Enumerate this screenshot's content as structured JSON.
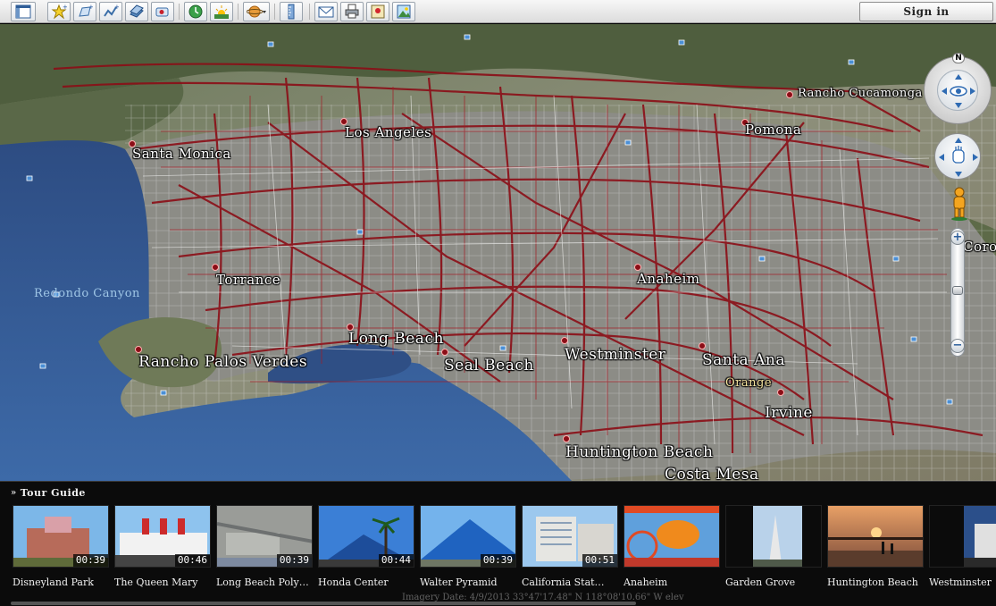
{
  "toolbar": {
    "buttons": [
      {
        "icon": "sidebar-toggle-icon"
      },
      {
        "icon": "add-placemark-icon"
      },
      {
        "icon": "add-polygon-icon"
      },
      {
        "icon": "add-path-icon"
      },
      {
        "icon": "add-image-overlay-icon"
      },
      {
        "icon": "record-tour-icon"
      },
      {
        "icon": "historical-imagery-icon"
      },
      {
        "icon": "sunlight-icon"
      },
      {
        "icon": "planets-icon"
      },
      {
        "icon": "ruler-icon"
      },
      {
        "icon": "email-icon"
      },
      {
        "icon": "print-icon"
      },
      {
        "icon": "view-in-maps-icon"
      },
      {
        "icon": "save-image-icon"
      }
    ],
    "sign_in_label": "Sign in"
  },
  "map": {
    "cities": [
      {
        "name": "Rancho Cucamonga"
      },
      {
        "name": "Los Angeles"
      },
      {
        "name": "Pomona"
      },
      {
        "name": "Santa Monica"
      },
      {
        "name": "Corona"
      },
      {
        "name": "Torrance"
      },
      {
        "name": "Anaheim"
      },
      {
        "name": "Redondo Canyon"
      },
      {
        "name": "Long Beach"
      },
      {
        "name": "Rancho Palos Verdes"
      },
      {
        "name": "Seal Beach"
      },
      {
        "name": "Westminster"
      },
      {
        "name": "Santa Ana"
      },
      {
        "name": "Orange"
      },
      {
        "name": "Irvine"
      },
      {
        "name": "Huntington Beach"
      },
      {
        "name": "Costa Mesa"
      }
    ],
    "compass_north_label": "N",
    "colors": {
      "roads": "#8b0e17",
      "water": "#3b5a8a",
      "land": "#6d7656"
    }
  },
  "tour_guide": {
    "title": "Tour Guide",
    "items": [
      {
        "label": "Disneyland Park",
        "duration": "00:39",
        "thumb": "disneyland"
      },
      {
        "label": "The Queen Mary",
        "duration": "00:46",
        "thumb": "ship"
      },
      {
        "label": "Long Beach Poly…",
        "duration": "00:39",
        "thumb": "aerial"
      },
      {
        "label": "Honda Center",
        "duration": "00:44",
        "thumb": "palms"
      },
      {
        "label": "Walter Pyramid",
        "duration": "00:39",
        "thumb": "pyramid"
      },
      {
        "label": "California Stat…",
        "duration": "00:51",
        "thumb": "building"
      },
      {
        "label": "Anaheim",
        "duration": "",
        "thumb": "ride"
      },
      {
        "label": "Garden Grove",
        "duration": "",
        "thumb": "tower"
      },
      {
        "label": "Huntington Beach",
        "duration": "",
        "thumb": "sunset"
      },
      {
        "label": "Westminster",
        "duration": "",
        "thumb": "dusk"
      }
    ],
    "status_text": "Imagery Date: 4/9/2013   33°47'17.48\" N 118°08'10.66\" W  elev"
  }
}
